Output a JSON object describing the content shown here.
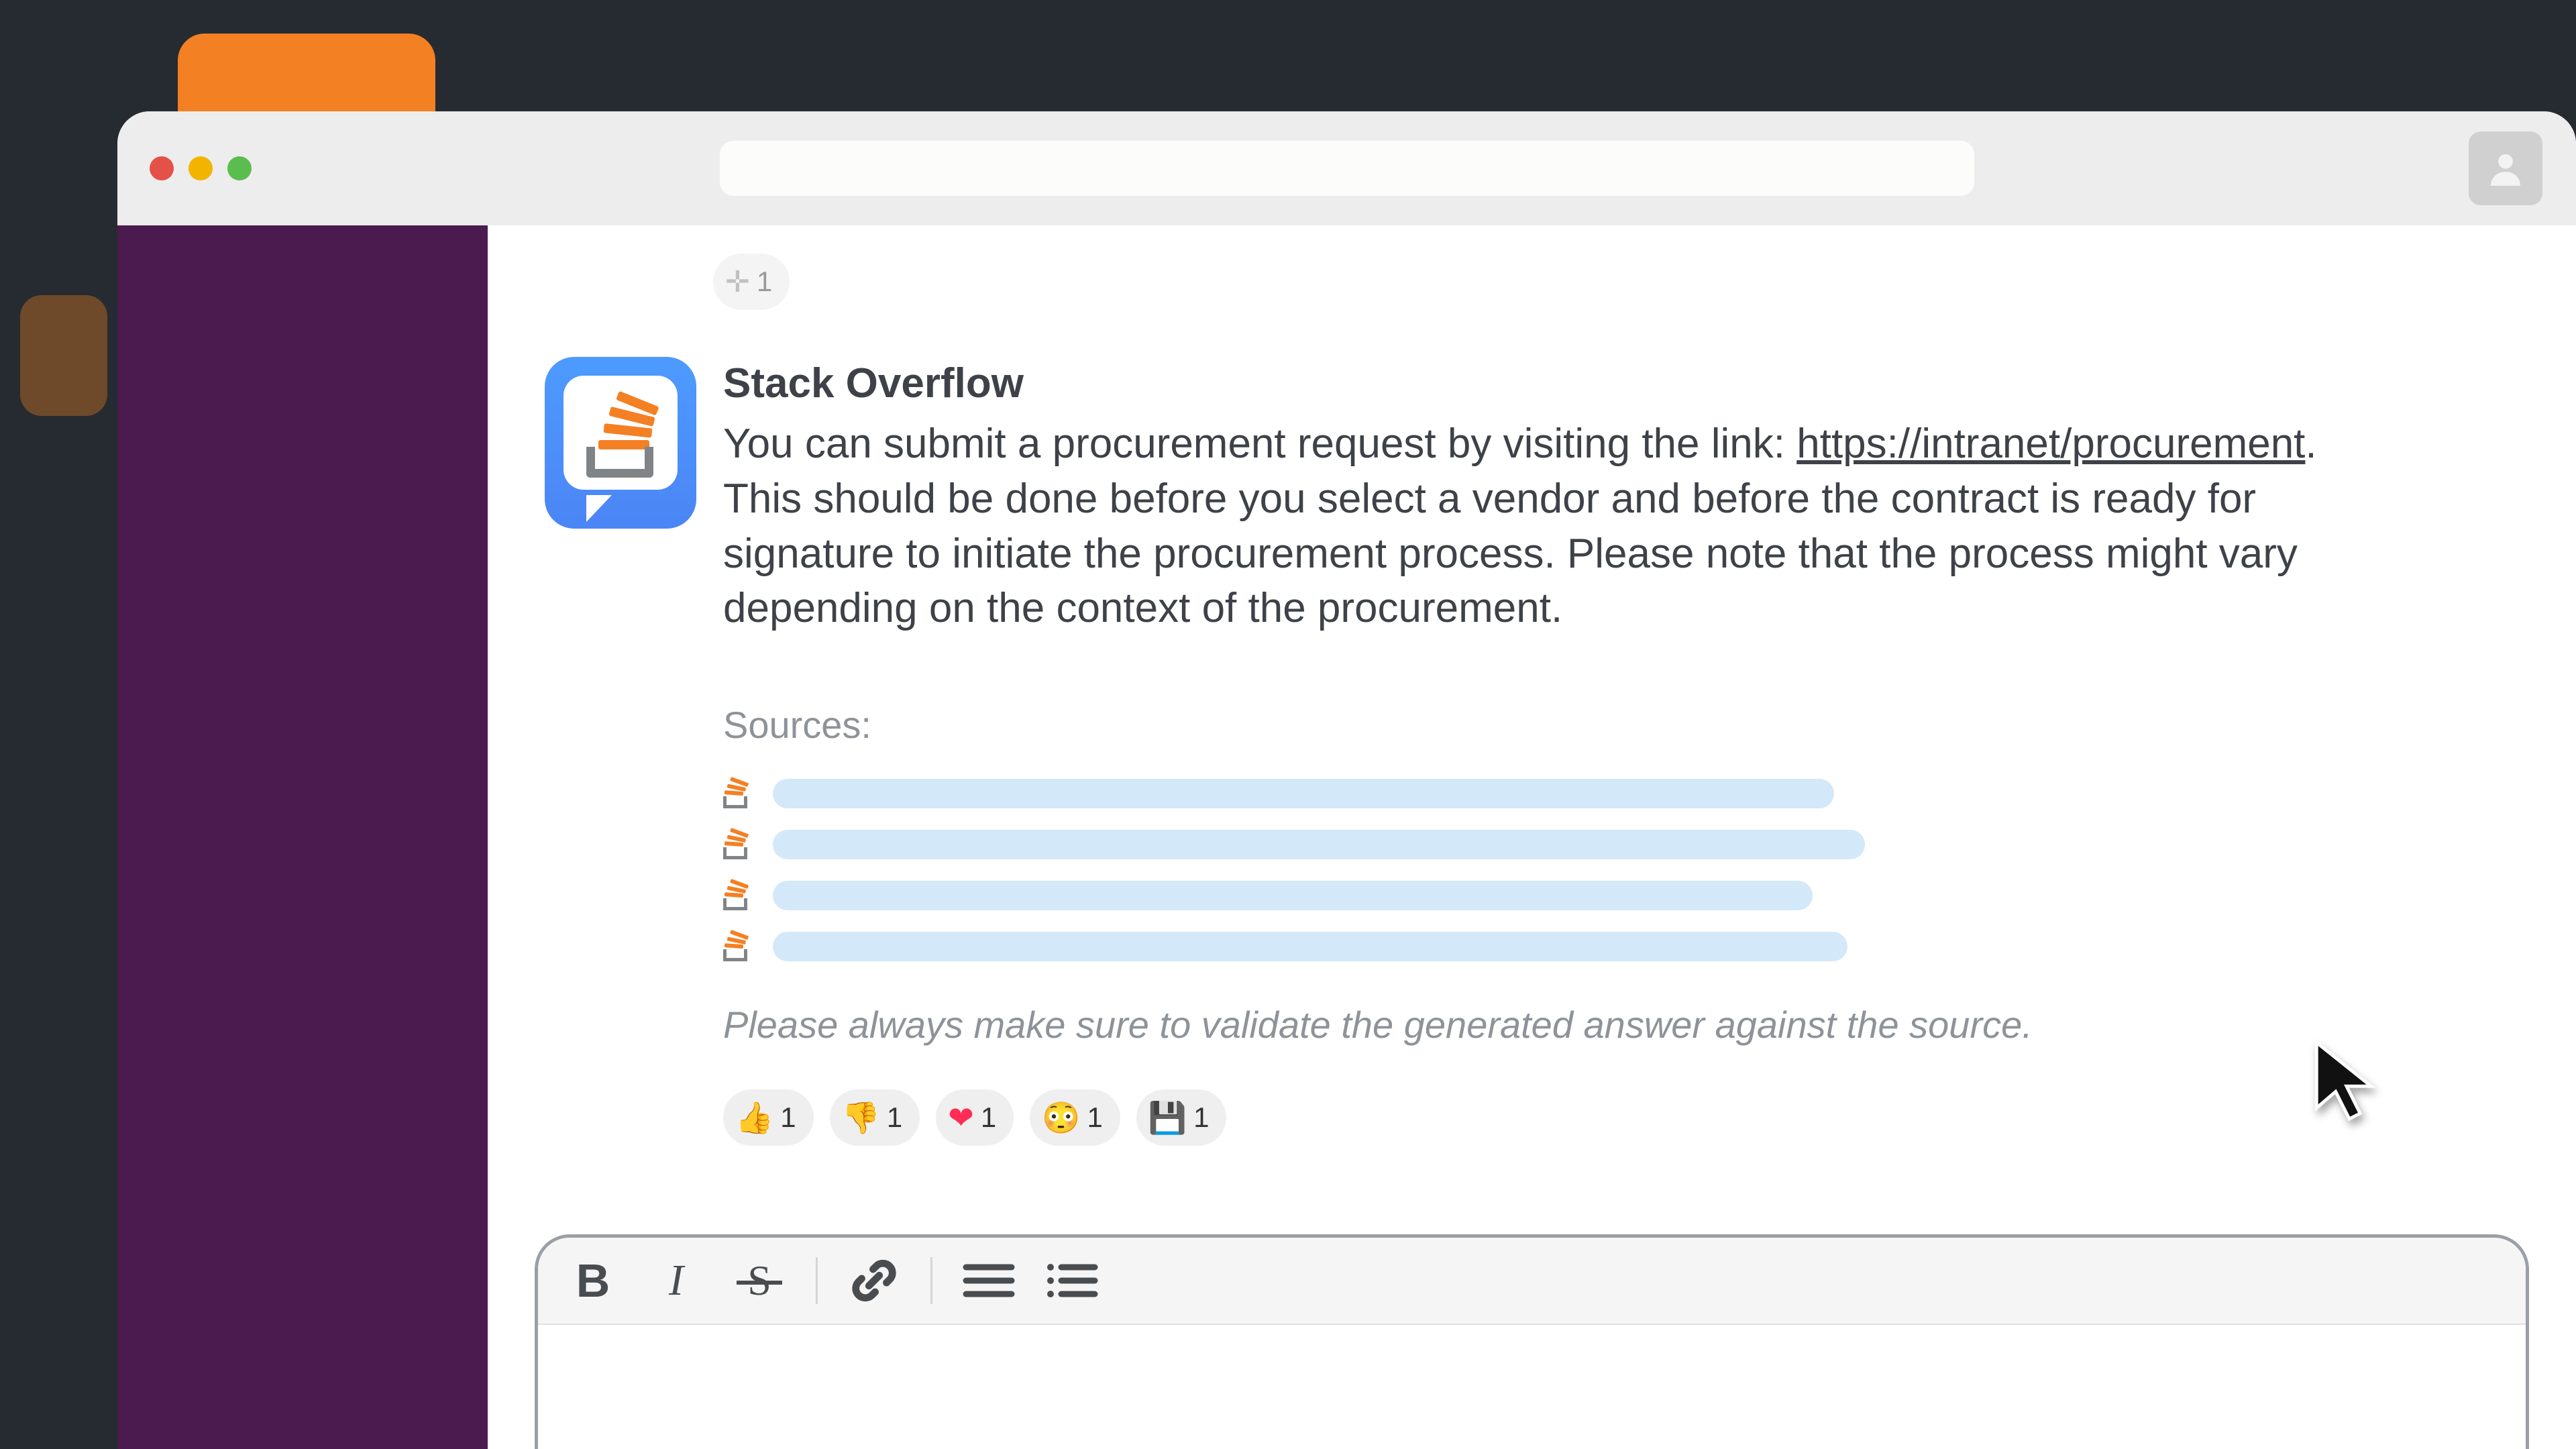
{
  "message": {
    "sender": "Stack Overflow",
    "text_before_link": "You can submit a procurement request by visiting the link: ",
    "link_text": "https://intranet/procurement",
    "text_after_link": ". This should be done before you select a vendor and before the contract is ready for signature to initiate the procurement process. Please note that the process might vary depending on the context of the procurement."
  },
  "sources_label": "Sources:",
  "source_bar_widths": [
    1582,
    1628,
    1550,
    1602
  ],
  "disclaimer": "Please always make sure to validate the generated answer against the source.",
  "top_add_reaction_count": "1",
  "reactions": [
    {
      "emoji": "👍",
      "count": "1",
      "name": "thumbs-up"
    },
    {
      "emoji": "👎",
      "count": "1",
      "name": "thumbs-down"
    },
    {
      "emoji": "❤",
      "count": "1",
      "name": "heart",
      "is_heart": true
    },
    {
      "emoji": "😳",
      "count": "1",
      "name": "flushed"
    },
    {
      "emoji": "💾",
      "count": "1",
      "name": "save"
    }
  ]
}
